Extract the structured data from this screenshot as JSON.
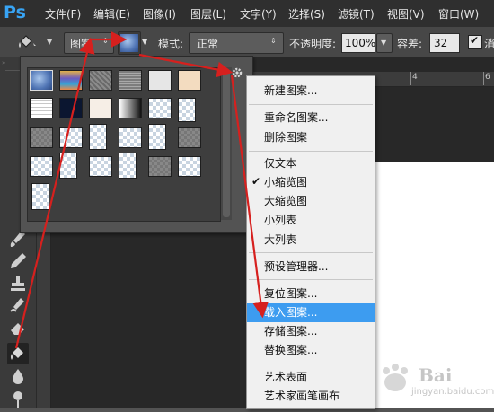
{
  "app": {
    "logo": "Ps"
  },
  "menubar": {
    "items": [
      "文件(F)",
      "编辑(E)",
      "图像(I)",
      "图层(L)",
      "文字(Y)",
      "选择(S)",
      "滤镜(T)",
      "视图(V)",
      "窗口(W)"
    ]
  },
  "options": {
    "fill_source": "图案",
    "mode_label": "模式:",
    "mode_value": "正常",
    "opacity_label": "不透明度:",
    "opacity_value": "100%",
    "tolerance_label": "容差:",
    "tolerance_value": "32",
    "antialias_label": "消"
  },
  "ruler": {
    "tick_4": "4",
    "tick_6": "6"
  },
  "context_menu": {
    "items": [
      "新建图案...",
      "重命名图案...",
      "删除图案",
      "仅文本",
      "小缩览图",
      "大缩览图",
      "小列表",
      "大列表",
      "预设管理器...",
      "复位图案...",
      "载入图案...",
      "存储图案...",
      "替换图案...",
      "艺术表面",
      "艺术家画笔画布"
    ],
    "checked_item": "小缩览图",
    "highlighted_item": "载入图案..."
  },
  "colors": {
    "accent_highlight": "#3d9cf0",
    "annotation_red": "#d6201e",
    "ps_blue": "#38a4f4"
  },
  "watermark": {
    "brand": "Bai",
    "url": "jingyan.baidu.com"
  }
}
